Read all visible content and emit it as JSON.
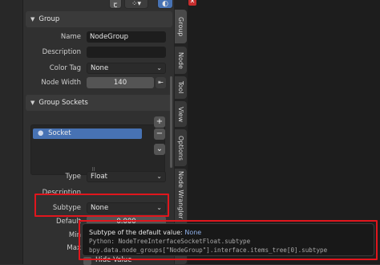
{
  "header": {
    "tool_icon": "tool-glyph-icon",
    "grid_icon": "grid-icon",
    "overlay_icon": "overlay-icon",
    "close_icon": "close-icon"
  },
  "group_panel": {
    "title": "Group",
    "fields": {
      "name_label": "Name",
      "name_value": "NodeGroup",
      "description_label": "Description",
      "description_value": "",
      "color_tag_label": "Color Tag",
      "color_tag_value": "None",
      "node_width_label": "Node Width",
      "node_width_value": "140"
    }
  },
  "sockets_panel": {
    "title": "Group Sockets",
    "items": [
      "Socket"
    ],
    "add_label": "+",
    "remove_label": "−",
    "more_label": "⌄",
    "grip": "⠿",
    "type_label": "Type",
    "type_value": "Float",
    "description_label": "Description",
    "subtype_label": "Subtype",
    "subtype_value": "None",
    "default_label": "Default",
    "default_value": "0.000",
    "min_label": "Min",
    "max_label": "Max",
    "hide_value_label": "Hide Value"
  },
  "tabs": [
    "Group",
    "Node",
    "Tool",
    "View",
    "Options",
    "Node Wrangler"
  ],
  "tooltip": {
    "title": "Subtype of the default value:",
    "title_value": "None",
    "python_line": "Python: NodeTreeInterfaceSocketFloat.subtype",
    "data_path": "bpy.data.node_groups[\"NodeGroup\"].interface.items_tree[0].subtype"
  },
  "colors": {
    "highlight_red": "#e0161d",
    "accent_blue": "#4772b3",
    "panel_bg": "#303030"
  }
}
